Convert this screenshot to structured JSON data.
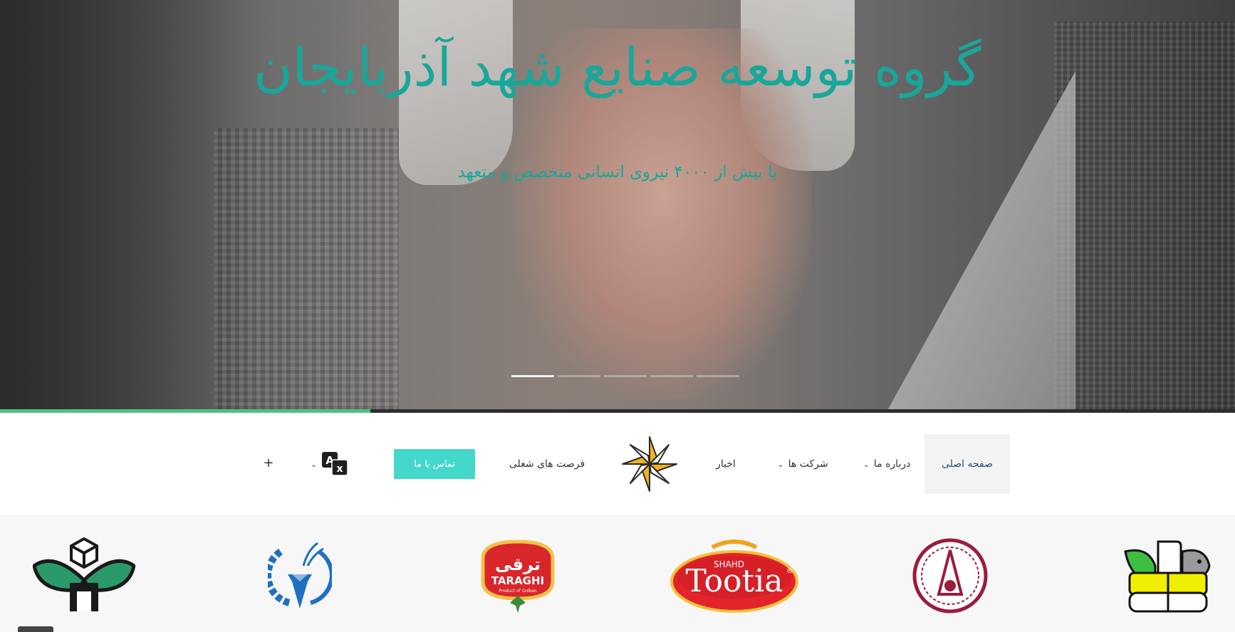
{
  "hero": {
    "title": "گروه توسعه صنایع شهد آذربایجان",
    "subtitle": "با بیش از ۴۰۰۰ نیروی انسانی متخصص و متعهد",
    "slides_total": 5,
    "slide_active": 1,
    "slide_progress": 0.3
  },
  "nav": {
    "home": "صفحه اصلی",
    "about": "درباره ما",
    "companies": "شرکت ها",
    "news": "اخبار",
    "careers": "فرصت های شغلی",
    "contact": "تماس با ما",
    "plus": "+",
    "chevron": "⌄"
  },
  "brands": {
    "tootia_top": "SHAHD",
    "tootia_name": "Tootia",
    "tootia_mark": "®",
    "taraghi_fa": "ترقی",
    "taraghi_en": "TARAGHI",
    "taraghi_tag": "Product of Golkan"
  },
  "colors": {
    "accent": "#18a79a",
    "button": "#43d8c9",
    "progress": "#4fc27e"
  },
  "icons": {
    "language": "translate-icon",
    "chevron": "chevron-down-icon"
  }
}
